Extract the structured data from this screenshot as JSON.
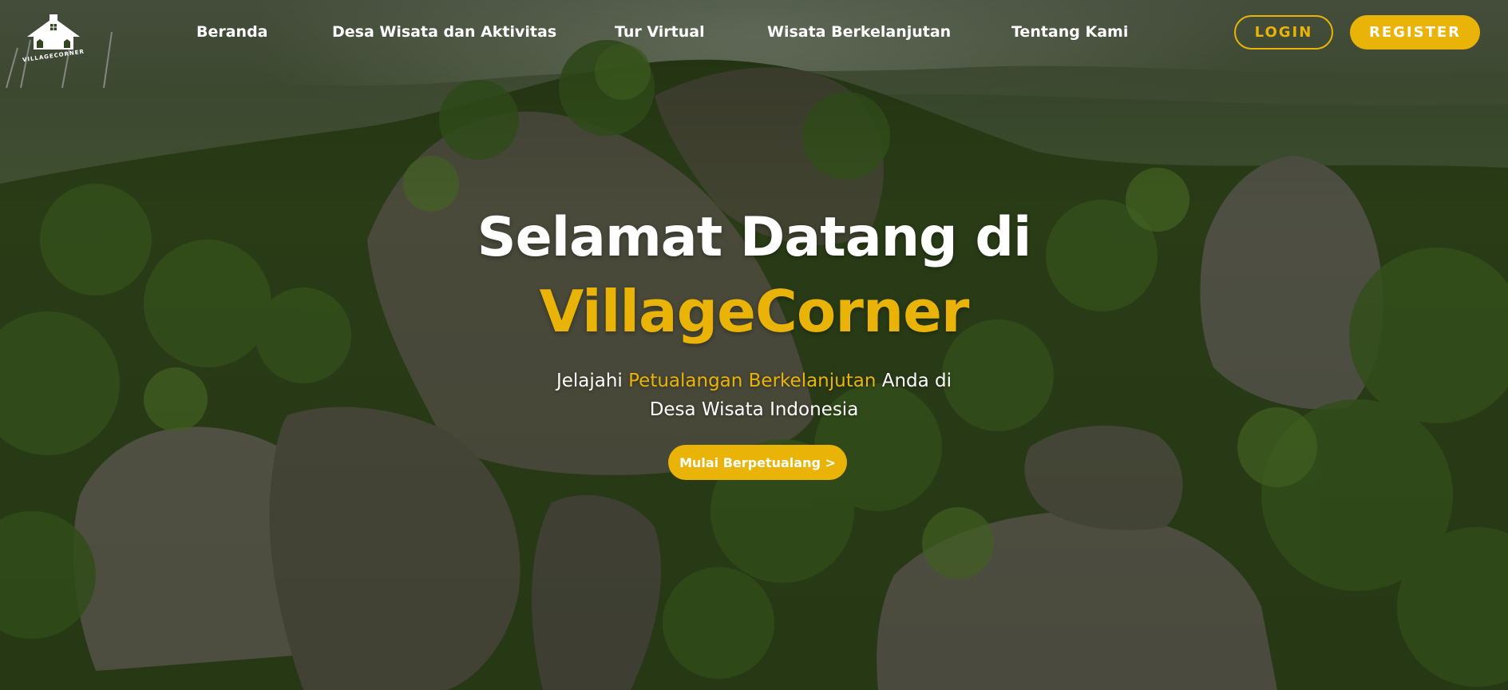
{
  "brand": {
    "logo_text": "VILLAGECORNER",
    "accent_color": "#eab308"
  },
  "nav": {
    "links": [
      {
        "label": "Beranda"
      },
      {
        "label": "Desa Wisata dan Aktivitas"
      },
      {
        "label": "Tur Virtual"
      },
      {
        "label": "Wisata Berkelanjutan"
      },
      {
        "label": "Tentang Kami"
      }
    ],
    "login_label": "LOGIN",
    "register_label": "REGISTER"
  },
  "hero": {
    "title_line1": "Selamat Datang di",
    "title_line2": "VillageCorner",
    "subtitle_prefix": "Jelajahi",
    "subtitle_highlight": "Petualangan Berkelanjutan",
    "subtitle_suffix": "Anda di",
    "subtitle_line2": "Desa Wisata Indonesia",
    "cta_label": "Mulai Berpetualang >"
  }
}
